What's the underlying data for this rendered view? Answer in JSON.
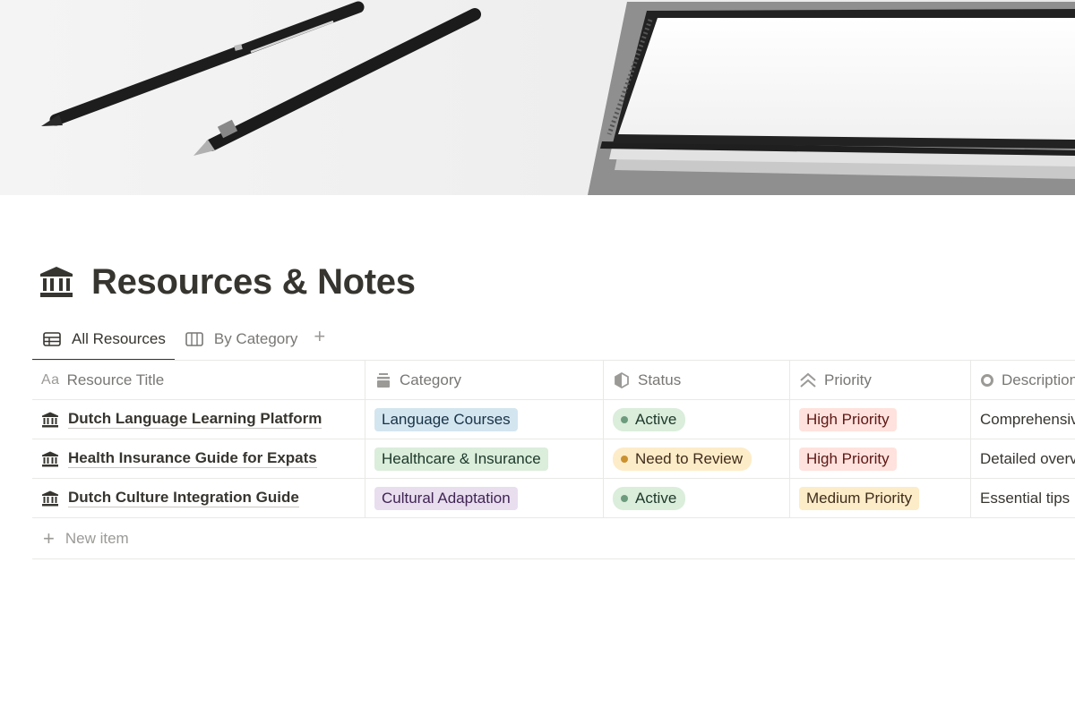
{
  "page": {
    "title": "Resources & Notes",
    "icon": "bank-icon"
  },
  "tabs": [
    {
      "label": "All Resources",
      "icon": "table-icon",
      "active": true
    },
    {
      "label": "By Category",
      "icon": "board-icon",
      "active": false
    }
  ],
  "table": {
    "columns": [
      {
        "label": "Resource Title",
        "icon": "text-property-icon",
        "icon_text": "Aa"
      },
      {
        "label": "Category",
        "icon": "select-property-icon"
      },
      {
        "label": "Status",
        "icon": "status-property-icon"
      },
      {
        "label": "Priority",
        "icon": "priority-chevrons-icon"
      },
      {
        "label": "Description",
        "icon": "text-circle-icon"
      }
    ],
    "rows": [
      {
        "title": "Dutch Language Learning Platform",
        "category": {
          "label": "Language Courses",
          "bg": "#d3e5ef",
          "fg": "#183347"
        },
        "status": {
          "label": "Active",
          "bg": "#dbeddb",
          "dot": "#6c9b7d",
          "fg": "#1c3829"
        },
        "priority": {
          "label": "High Priority",
          "bg": "#ffe2dd",
          "fg": "#5d1715"
        },
        "description": "Comprehensive"
      },
      {
        "title": "Health Insurance Guide for Expats",
        "category": {
          "label": "Healthcare & Insurance",
          "bg": "#dbeddb",
          "fg": "#1c3829"
        },
        "status": {
          "label": "Need to Review",
          "bg": "#fdecc8",
          "dot": "#cb912f",
          "fg": "#402c1b"
        },
        "priority": {
          "label": "High Priority",
          "bg": "#ffe2dd",
          "fg": "#5d1715"
        },
        "description": "Detailed overview"
      },
      {
        "title": "Dutch Culture Integration Guide",
        "category": {
          "label": "Cultural Adaptation",
          "bg": "#e8deee",
          "fg": "#412454"
        },
        "status": {
          "label": "Active",
          "bg": "#dbeddb",
          "dot": "#6c9b7d",
          "fg": "#1c3829"
        },
        "priority": {
          "label": "Medium Priority",
          "bg": "#fdecc8",
          "fg": "#402c1b"
        },
        "description": "Essential tips"
      }
    ],
    "new_item_label": "New item"
  }
}
